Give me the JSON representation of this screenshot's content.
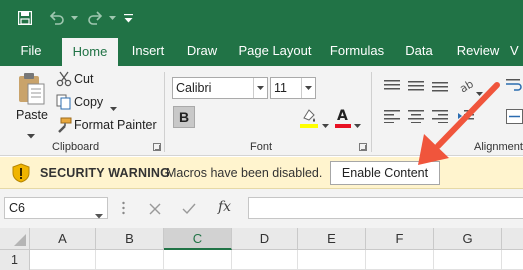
{
  "tabs": [
    {
      "label": "File"
    },
    {
      "label": "Home"
    },
    {
      "label": "Insert"
    },
    {
      "label": "Draw"
    },
    {
      "label": "Page Layout"
    },
    {
      "label": "Formulas"
    },
    {
      "label": "Data"
    },
    {
      "label": "Review"
    },
    {
      "label": "V"
    }
  ],
  "clipboard": {
    "paste_label": "Paste",
    "cut_label": "Cut",
    "copy_label": "Copy",
    "format_painter_label": "Format Painter",
    "group_label": "Clipboard"
  },
  "font": {
    "font_name": "Calibri",
    "font_size": "11",
    "bold": "B",
    "group_label": "Font"
  },
  "alignment": {
    "group_label": "Alignment"
  },
  "security": {
    "title": "SECURITY WARNING",
    "message": "Macros have been disabled.",
    "button_label": "Enable Content"
  },
  "formula_bar": {
    "name_box": "C6",
    "fx_label": "fx"
  },
  "grid": {
    "columns": [
      "A",
      "B",
      "C",
      "D",
      "E",
      "F",
      "G"
    ],
    "selected_column": "C",
    "rows": [
      "1"
    ]
  },
  "colors": {
    "excel_green": "#217346",
    "warning_bg": "#fff4ce",
    "arrow": "#f0553c",
    "font_color_red": "#e81123",
    "highlight_yellow": "#ffff00"
  },
  "icons": {
    "save": "save-icon",
    "undo": "undo-icon",
    "redo": "redo-icon",
    "shield": "shield-warning-icon",
    "cancel": "cancel-icon",
    "enter": "check-icon"
  }
}
